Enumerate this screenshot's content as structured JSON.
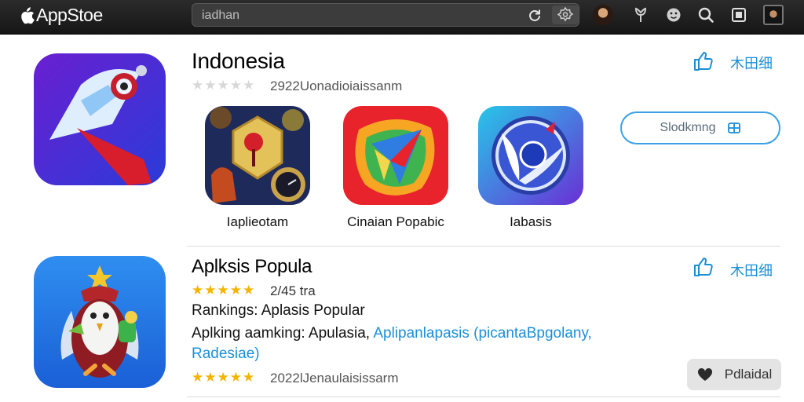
{
  "topbar": {
    "brand": "AppStoe",
    "search_value": "iadhan"
  },
  "featured": {
    "title": "Indonesia",
    "rating_stars": 0,
    "meta": "2922Uonadioiaissanm",
    "like_label": "木田细",
    "action_button": "Slodkmng"
  },
  "tiles": [
    {
      "label": "Iaplieotam"
    },
    {
      "label": "Cinaian Popabic"
    },
    {
      "label": "Iabasis"
    }
  ],
  "popular": {
    "title": "Aplksis Popula",
    "rating_stars": 5,
    "rating_text": "2/45 tra",
    "rankings_line": "Rankings: Aplasis Popular",
    "line2_prefix": "Aplking aamking: Apulasia,",
    "line2_link": "Aplipanlapasis (picantaBpgolany,",
    "line3_link": "Radesiae)",
    "meta": "2022lJenaulaisissarm",
    "like_label": "木田细",
    "action_button": "Pdlaidal"
  },
  "colors": {
    "accent": "#1a8fd8",
    "star": "#f5b400",
    "topbar": "#1f1f1f"
  }
}
